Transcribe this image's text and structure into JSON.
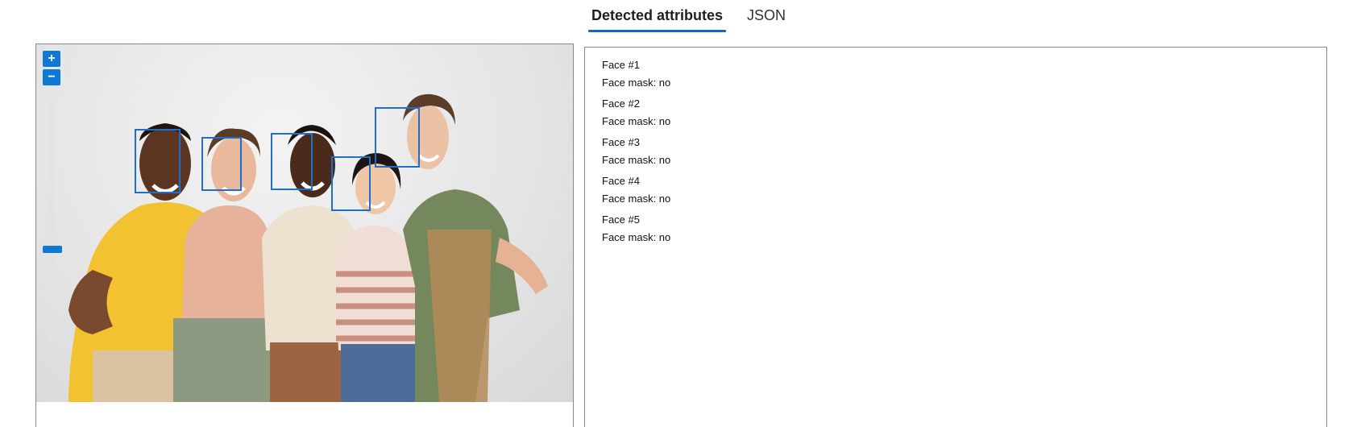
{
  "tabs": [
    {
      "label": "Detected attributes",
      "active": true
    },
    {
      "label": "JSON",
      "active": false
    }
  ],
  "zoom": {
    "in_label": "+",
    "out_label": "−"
  },
  "faces": [
    {
      "title": "Face #1",
      "mask": "Face mask: no"
    },
    {
      "title": "Face #2",
      "mask": "Face mask: no"
    },
    {
      "title": "Face #3",
      "mask": "Face mask: no"
    },
    {
      "title": "Face #4",
      "mask": "Face mask: no"
    },
    {
      "title": "Face #5",
      "mask": "Face mask: no"
    }
  ],
  "colors": {
    "accent": "#0f78d4",
    "tab_underline": "#0f6cbd",
    "face_box": "#1f6fc9"
  }
}
